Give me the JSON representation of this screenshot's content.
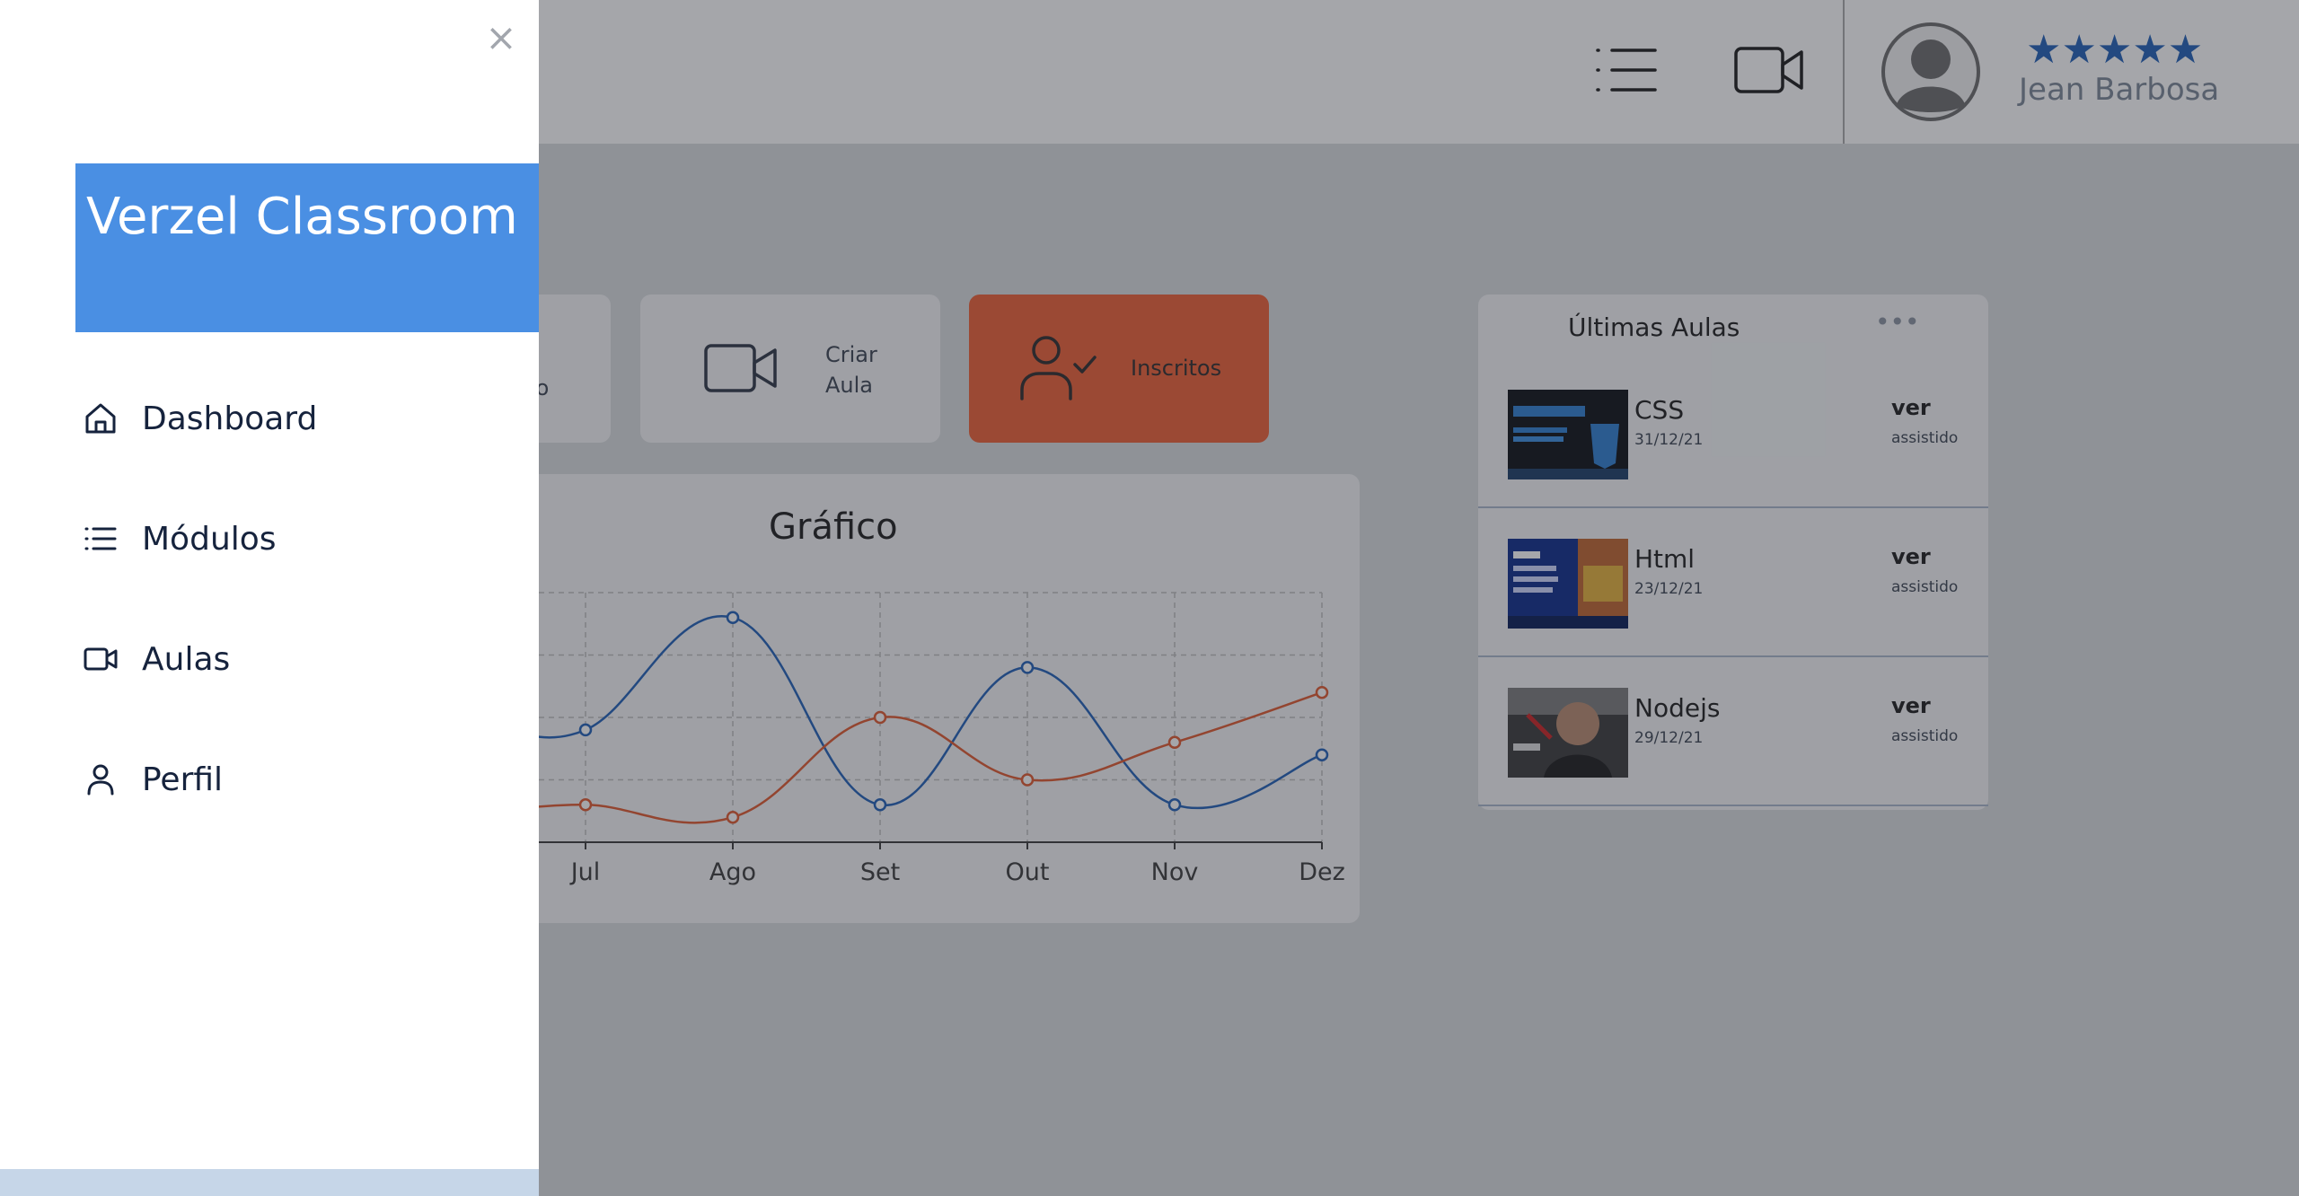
{
  "topbar": {
    "list_icon": "list-icon",
    "video_icon": "video-camera-icon",
    "user": {
      "rating": "★★★★★",
      "name": "Jean Barbosa",
      "avatar_icon": "user-avatar-icon"
    }
  },
  "cards": {
    "partial_label": "lo",
    "criar_label": "Criar Aula",
    "inscritos_label": "Inscritos"
  },
  "chart_data": {
    "type": "line",
    "title": "Gráfico",
    "categories": [
      "Jul",
      "Ago",
      "Set",
      "Out",
      "Nov",
      "Dez"
    ],
    "ylim": [
      0,
      100
    ],
    "grid": true,
    "series": [
      {
        "values": [
          45,
          90,
          15,
          70,
          15,
          35
        ],
        "color": "#1f5fb7"
      },
      {
        "values": [
          15,
          10,
          50,
          25,
          40,
          60
        ],
        "color": "#e0582e"
      }
    ]
  },
  "lessons": {
    "title": "Últimas Aulas",
    "more": "•••",
    "items": [
      {
        "name": "CSS",
        "date": "31/12/21",
        "action": "ver",
        "status": "assistido"
      },
      {
        "name": "Html",
        "date": "23/12/21",
        "action": "ver",
        "status": "assistido"
      },
      {
        "name": "Nodejs",
        "date": "29/12/21",
        "action": "ver",
        "status": "assistido"
      }
    ]
  },
  "drawer": {
    "close": "×",
    "brand": "Verzel Classroom",
    "nav": [
      {
        "label": "Dashboard",
        "icon": "home-icon"
      },
      {
        "label": "Módulos",
        "icon": "list-icon"
      },
      {
        "label": "Aulas",
        "icon": "video-camera-icon"
      },
      {
        "label": "Perfil",
        "icon": "user-icon"
      }
    ]
  },
  "colors": {
    "brand": "#4a8fe3",
    "accent": "#ee6035",
    "star": "#1f5fb7"
  }
}
